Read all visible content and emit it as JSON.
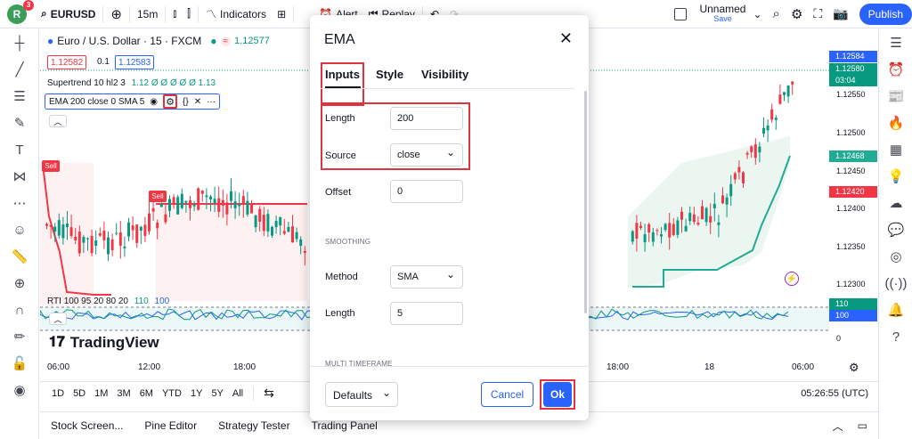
{
  "topbar": {
    "avatar_letter": "R",
    "notif_count": "3",
    "symbol": "EURUSD",
    "interval": "15m",
    "indicators_label": "Indicators",
    "alert_label": "Alert",
    "replay_label": "Replay",
    "layout_name": "Unnamed",
    "save_label": "Save",
    "publish_label": "Publish"
  },
  "chart": {
    "title": "Euro / U.S. Dollar · 15 · FXCM",
    "last_price": "1.12577",
    "bid": "1.12582",
    "spread": "0.1",
    "ask": "1.12583",
    "supertrend_label": "Supertrend 10 hl2 3",
    "supertrend_values": "1.12 Ø Ø Ø Ø Ø 1.13",
    "ema_label": "EMA 200 close 0 SMA 5",
    "rti_label": "RTI 100 95 20 80 20",
    "rti_v1": "110",
    "rti_v2": "100",
    "sell_label": "Sell",
    "logo": "TradingView",
    "price_scale": [
      "1.12550",
      "1.12500",
      "1.12450",
      "1.12400",
      "1.12350",
      "1.12300"
    ],
    "price_tags": [
      {
        "text": "1.12584",
        "color": "#2962ff"
      },
      {
        "text": "1.12580",
        "color": "#089981"
      },
      {
        "text": "03:04",
        "color": "#089981"
      },
      {
        "text": "1.12468",
        "color": "#22ab94"
      },
      {
        "text": "1.12420",
        "color": "#f23645"
      }
    ],
    "rti_scale": [
      "110",
      "100",
      "0"
    ],
    "time_labels": [
      "06:00",
      "12:00",
      "18:00",
      "18:00",
      "18",
      "06:00"
    ],
    "ranges": [
      "1D",
      "5D",
      "1M",
      "3M",
      "6M",
      "YTD",
      "1Y",
      "5Y",
      "All"
    ],
    "clock": "05:26:55 (UTC)",
    "up_color": "#089981",
    "down_color": "#f23645"
  },
  "bottom_tabs": [
    "Stock Screen...",
    "Pine Editor",
    "Strategy Tester",
    "Trading Panel"
  ],
  "modal": {
    "title": "EMA",
    "tabs": [
      "Inputs",
      "Style",
      "Visibility"
    ],
    "length_label": "Length",
    "length_value": "200",
    "source_label": "Source",
    "source_value": "close",
    "offset_label": "Offset",
    "offset_value": "0",
    "smoothing_header": "SMOOTHING",
    "method_label": "Method",
    "method_value": "SMA",
    "smooth_length_label": "Length",
    "smooth_length_value": "5",
    "multi_header": "MULTI TIMEFRAME",
    "defaults_label": "Defaults",
    "cancel_label": "Cancel",
    "ok_label": "Ok"
  }
}
